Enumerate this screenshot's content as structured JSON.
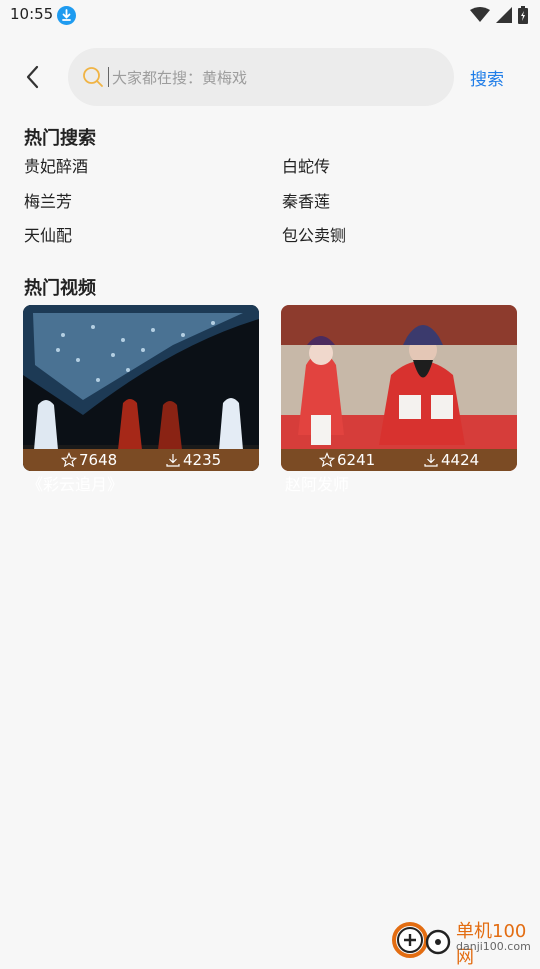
{
  "status_bar": {
    "time": "10:55"
  },
  "search": {
    "placeholder": "大家都在搜：黄梅戏",
    "button_label": "搜索"
  },
  "hot_search": {
    "title": "热门搜索",
    "items": [
      "贵妃醉酒",
      "白蛇传",
      "梅兰芳",
      "秦香莲",
      "天仙配",
      "包公卖铡"
    ]
  },
  "hot_videos": {
    "title": "热门视频",
    "videos": [
      {
        "title": "《彩云追月》",
        "likes": "7648",
        "downloads": "4235"
      },
      {
        "title": "赵阿发师",
        "likes": "6241",
        "downloads": "4424"
      }
    ]
  },
  "watermark": {
    "name": "单机100网",
    "url": "danji100.com"
  },
  "colors": {
    "accent": "#1f7de8",
    "stat_bar": "#7b4b24",
    "search_icon": "#f0b445"
  }
}
